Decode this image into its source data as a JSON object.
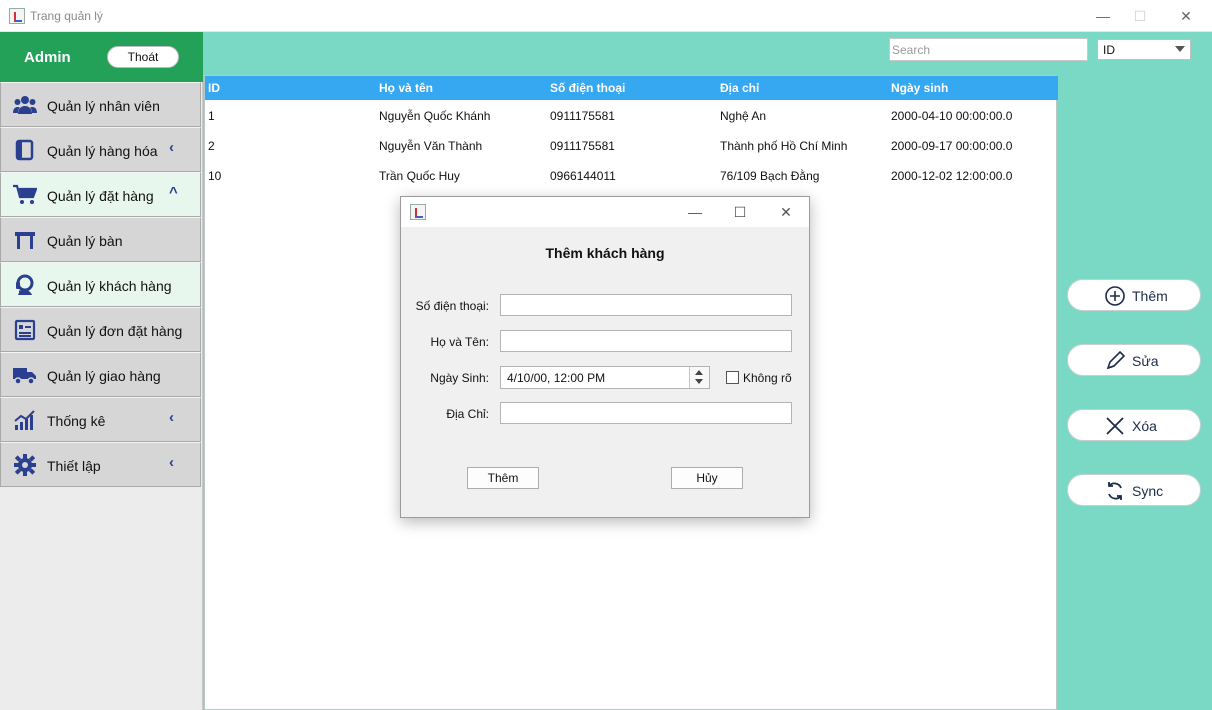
{
  "window": {
    "title": "Trang quản lý",
    "minimize": "—",
    "maximize": "☐",
    "close": "✕"
  },
  "sidebar": {
    "user": "Admin",
    "logout_label": "Thoát",
    "items": [
      {
        "label": "Quản lý nhân viên",
        "icon": "users-icon",
        "chevron": ""
      },
      {
        "label": "Quản lý hàng hóa",
        "icon": "box-icon",
        "chevron": "‹"
      },
      {
        "label": "Quản lý đặt hàng",
        "icon": "cart-icon",
        "chevron": "^",
        "active": true
      },
      {
        "label": "Quản lý bàn",
        "icon": "table-icon",
        "chevron": ""
      },
      {
        "label": "Quản lý khách hàng",
        "icon": "customer-support-icon",
        "chevron": "",
        "active": true
      },
      {
        "label": "Quản lý đơn đặt hàng",
        "icon": "order-list-icon",
        "chevron": ""
      },
      {
        "label": "Quản lý giao hàng",
        "icon": "truck-icon",
        "chevron": ""
      },
      {
        "label": "Thống kê",
        "icon": "chart-icon",
        "chevron": "‹"
      },
      {
        "label": "Thiết lập",
        "icon": "gear-icon",
        "chevron": "‹"
      }
    ]
  },
  "search": {
    "placeholder": "Search",
    "filter_value": "ID"
  },
  "table": {
    "columns": [
      "ID",
      "Họ và tên",
      "Số điện thoại",
      "Địa chỉ",
      "Ngày sinh"
    ],
    "rows": [
      [
        "1",
        "Nguyễn Quốc Khánh",
        "0911175581",
        "Nghệ An",
        "2000-04-10 00:00:00.0"
      ],
      [
        "2",
        "Nguyễn Văn Thành",
        "0911175581",
        "Thành phố Hồ Chí Minh",
        "2000-09-17 00:00:00.0"
      ],
      [
        "10",
        "Trần Quốc Huy",
        "0966144011",
        "76/109 Bạch Đằng",
        "2000-12-02 12:00:00.0"
      ]
    ]
  },
  "actions": {
    "add": "Thêm",
    "edit": "Sửa",
    "delete": "Xóa",
    "sync": "Sync"
  },
  "dialog": {
    "heading": "Thêm khách hàng",
    "phone_label": "Số điện thoại:",
    "name_label": "Họ và Tên:",
    "dob_label": "Ngày Sinh:",
    "dob_value": "4/10/00, 12:00 PM",
    "unknown_label": "Không rõ",
    "address_label": "Địa Chỉ:",
    "phone_value": "",
    "name_value": "",
    "address_value": "",
    "add_button": "Thêm",
    "cancel_button": "Hủy"
  },
  "colors": {
    "sidebar_header": "#24a158",
    "main_bg": "#7ad9c5",
    "table_header": "#36a8f2",
    "icon": "#2a3f8f"
  }
}
